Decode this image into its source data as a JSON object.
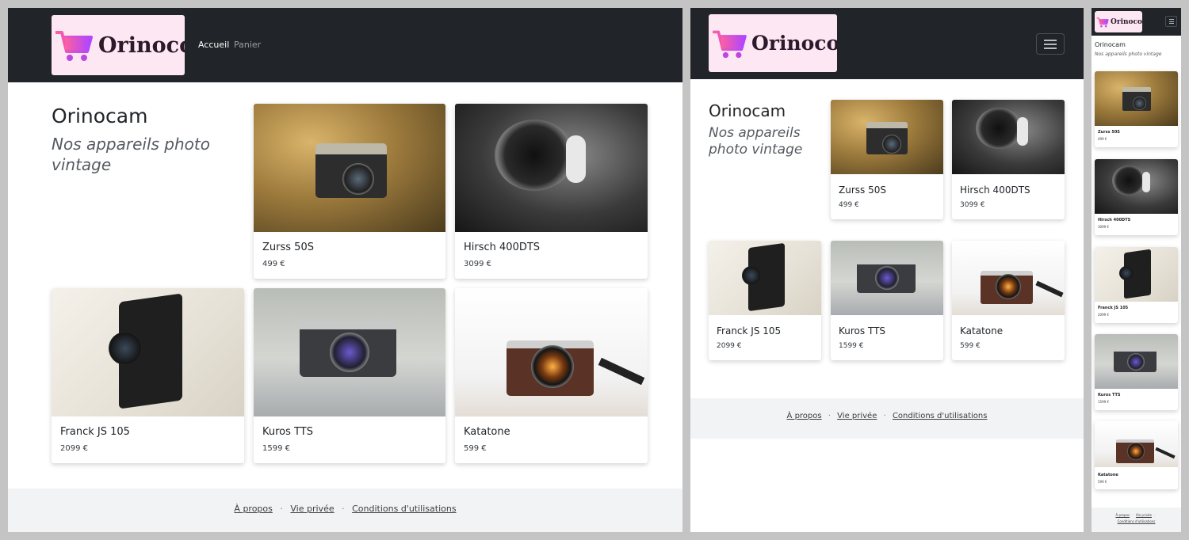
{
  "brand": {
    "name": "Orinoco"
  },
  "nav": {
    "home": "Accueil",
    "cart": "Panier"
  },
  "hero": {
    "title": "Orinocam",
    "subtitle": "Nos appareils photo vintage"
  },
  "products": [
    {
      "name": "Zurss 50S",
      "price": "499 €"
    },
    {
      "name": "Hirsch 400DTS",
      "price": "3099 €"
    },
    {
      "name": "Franck JS 105",
      "price": "2099 €"
    },
    {
      "name": "Kuros TTS",
      "price": "1599 €"
    },
    {
      "name": "Katatone",
      "price": "599 €"
    }
  ],
  "footer": {
    "about": "À propos",
    "privacy": "Vie privée",
    "terms": "Conditions d'utilisations",
    "separator": "·"
  },
  "colors": {
    "navbar": "#212529",
    "logo_bg": "#fde7f3",
    "footer_bg": "#f2f3f5",
    "page_bg": "#ffffff"
  },
  "icons": {
    "logo": "shopping-cart-icon",
    "menu": "hamburger-menu-icon"
  }
}
